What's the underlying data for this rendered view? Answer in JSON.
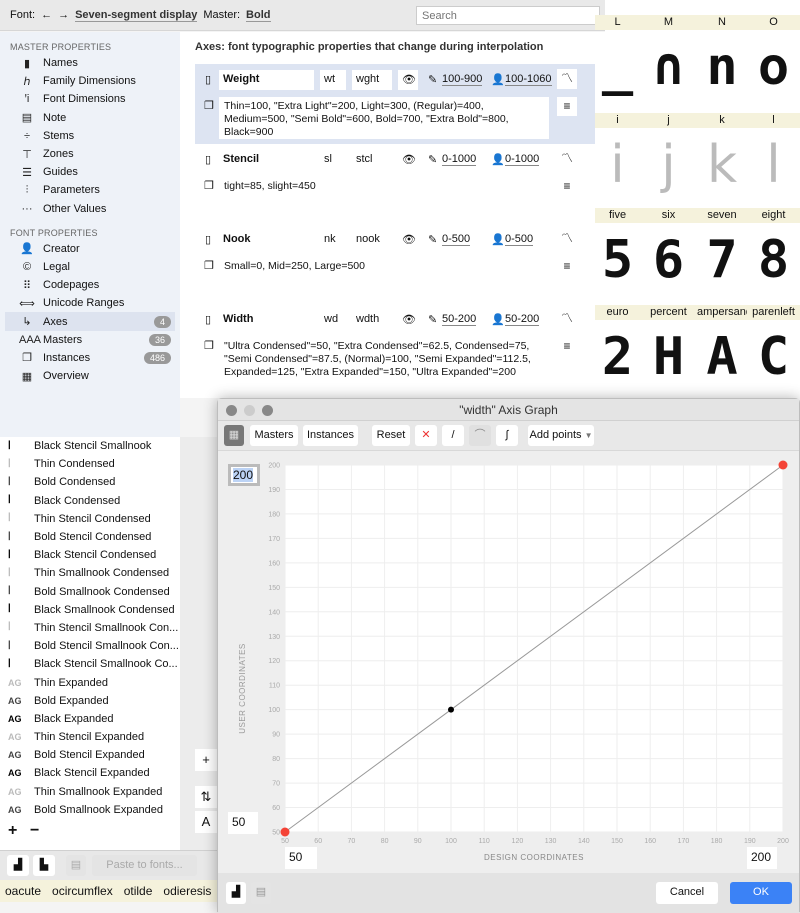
{
  "topbar": {
    "font_label": "Font:",
    "back": "←",
    "forward": "→",
    "font_name": "Seven-segment display",
    "master_label": "Master:",
    "master_name": "Bold",
    "search_placeholder": "Search"
  },
  "sidebar": {
    "master_header": "MASTER PROPERTIES",
    "master_items": [
      {
        "icon": "tag-icon",
        "glyph": "▮",
        "label": "Names"
      },
      {
        "icon": "family-dimensions-icon",
        "glyph": "ℎ",
        "label": "Family Dimensions"
      },
      {
        "icon": "font-dimensions-icon",
        "glyph": "ꞌi",
        "label": "Font Dimensions"
      },
      {
        "icon": "note-icon",
        "glyph": "▤",
        "label": "Note"
      },
      {
        "icon": "stems-icon",
        "glyph": "÷",
        "label": "Stems"
      },
      {
        "icon": "zones-icon",
        "glyph": "⊤",
        "label": "Zones"
      },
      {
        "icon": "guides-icon",
        "glyph": "☰",
        "label": "Guides"
      },
      {
        "icon": "parameters-icon",
        "glyph": "⫶",
        "label": "Parameters"
      },
      {
        "icon": "more-icon",
        "glyph": "···",
        "label": "Other Values"
      }
    ],
    "font_header": "FONT PROPERTIES",
    "font_items": [
      {
        "icon": "person-icon",
        "glyph": "👤",
        "label": "Creator"
      },
      {
        "icon": "legal-icon",
        "glyph": "©",
        "label": "Legal"
      },
      {
        "icon": "codepages-icon",
        "glyph": "⠿",
        "label": "Codepages"
      },
      {
        "icon": "unicode-icon",
        "glyph": "⟺",
        "label": "Unicode Ranges"
      },
      {
        "icon": "axes-icon",
        "glyph": "↳",
        "label": "Axes",
        "badge": "4",
        "selected": true
      },
      {
        "icon": "masters-icon",
        "glyph": "AAA",
        "label": "Masters",
        "badge": "36"
      },
      {
        "icon": "instances-icon",
        "glyph": "❐",
        "label": "Instances",
        "badge": "486"
      },
      {
        "icon": "overview-icon",
        "glyph": "▦",
        "label": "Overview"
      }
    ]
  },
  "content": {
    "title": "Axes: font typographic properties that change during interpolation",
    "axes": [
      {
        "name": "Weight",
        "short": "wt",
        "tag": "wght",
        "design_range": "100-900",
        "user_range": "100-1060",
        "instances": "Thin=100, \"Extra Light\"=200, Light=300, (Regular)=400, Medium=500, \"Semi Bold\"=600, Bold=700, \"Extra Bold\"=800, Black=900",
        "selected": true
      },
      {
        "name": "Stencil",
        "short": "sl",
        "tag": "stcl",
        "design_range": "0-1000",
        "user_range": "0-1000",
        "instances": "tight=85, slight=450"
      },
      {
        "name": "Nook",
        "short": "nk",
        "tag": "nook",
        "design_range": "0-500",
        "user_range": "0-500",
        "instances": "Small=0, Mid=250, Large=500"
      },
      {
        "name": "Width",
        "short": "wd",
        "tag": "wdth",
        "design_range": "50-200",
        "user_range": "50-200",
        "instances": "\"Ultra Condensed\"=50, \"Extra Condensed\"=62.5, Condensed=75, \"Semi Condensed\"=87.5, (Normal)=100, \"Semi Expanded\"=112.5, Expanded=125, \"Extra Expanded\"=150, \"Ultra Expanded\"=200"
      }
    ]
  },
  "glyphs": {
    "rows": [
      {
        "names": [
          "L",
          "M",
          "N",
          "O"
        ],
        "chars": [
          "_",
          "∩",
          "n",
          "o"
        ]
      },
      {
        "names": [
          "i",
          "j",
          "k",
          "l"
        ],
        "chars": [
          "i",
          "j",
          "k",
          "l"
        ]
      },
      {
        "names": [
          "five",
          "six",
          "seven",
          "eight"
        ],
        "chars": [
          "5",
          "6",
          "7",
          "8"
        ]
      },
      {
        "names": [
          "euro",
          "percent",
          "ampersand",
          "parenleft"
        ],
        "chars": [
          "2",
          "H",
          "A",
          "C"
        ]
      }
    ]
  },
  "masters_list": [
    "Black Stencil Smallnook",
    "Thin Condensed",
    "Bold Condensed",
    "Black Condensed",
    "Thin Stencil Condensed",
    "Bold Stencil Condensed",
    "Black Stencil Condensed",
    "Thin Smallnook Condensed",
    "Bold Smallnook Condensed",
    "Black Smallnook Condensed",
    "Thin Stencil Smallnook Con...",
    "Bold Stencil Smallnook Con...",
    "Black Stencil Smallnook Co...",
    "Thin Expanded",
    "Bold Expanded",
    "Black Expanded",
    "Thin Stencil Expanded",
    "Bold Stencil Expanded",
    "Black Stencil Expanded",
    "Thin Smallnook Expanded",
    "Bold Smallnook Expanded"
  ],
  "list_controls": {
    "add": "+",
    "remove": "−"
  },
  "bottombar": {
    "paste_to_fonts": "Paste to fonts..."
  },
  "glyph_names_strip": [
    "oacute",
    "ocircumflex",
    "otilde",
    "odieresis"
  ],
  "dialog": {
    "title": "\"width\" Axis Graph",
    "masters": "Masters",
    "instances": "Instances",
    "reset": "Reset",
    "add_points": "Add points",
    "cancel": "Cancel",
    "ok": "OK",
    "user_max": "200",
    "user_min": "50",
    "design_min": "50",
    "design_max": "200",
    "accent": "#3b82f6"
  },
  "chart_data": {
    "type": "line",
    "xlabel": "DESIGN COORDINATES",
    "ylabel": "USER COORDINATES",
    "xlim": [
      50,
      200
    ],
    "ylim": [
      50,
      200
    ],
    "xticks": [
      50,
      60,
      70,
      80,
      90,
      100,
      110,
      120,
      130,
      140,
      150,
      160,
      170,
      180,
      190,
      200
    ],
    "yticks": [
      50,
      60,
      70,
      80,
      90,
      100,
      110,
      120,
      130,
      140,
      150,
      160,
      170,
      180,
      190,
      200
    ],
    "grid": true,
    "points": [
      {
        "x": 50,
        "y": 50,
        "color": "#f44336"
      },
      {
        "x": 100,
        "y": 100,
        "color": "#000000"
      },
      {
        "x": 200,
        "y": 200,
        "color": "#f44336"
      }
    ]
  }
}
